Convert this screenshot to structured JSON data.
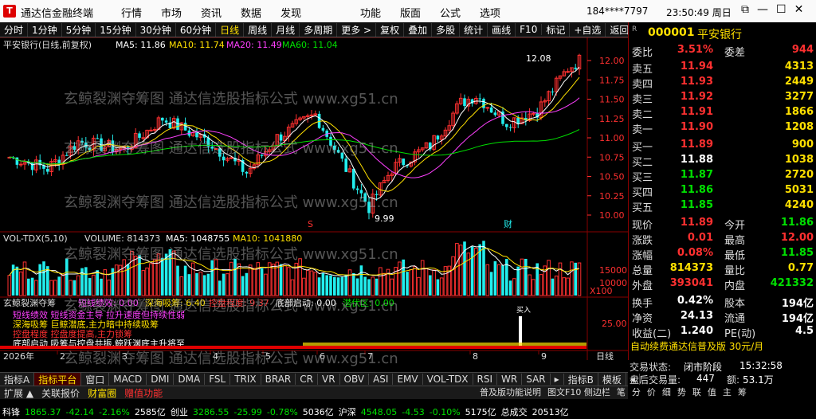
{
  "window": {
    "title": "通达信金融终端",
    "menu": [
      "行情",
      "市场",
      "资讯",
      "数据",
      "发现"
    ],
    "menu2": [
      "功能",
      "版面",
      "公式",
      "选项"
    ],
    "user": "184****7797",
    "clock": "23:50:49 周日"
  },
  "toolbar": [
    "分时",
    "1分钟",
    "5分钟",
    "15分钟",
    "30分钟",
    "60分钟",
    "日线",
    "周线",
    "月线",
    "多周期",
    "更多 >",
    "复权",
    "叠加",
    "多股",
    "统计",
    "画线",
    "F10",
    "标记",
    "+自选",
    "返回"
  ],
  "toolbar_selected": "日线",
  "main_chart": {
    "header": "平安银行(日线,前复权)",
    "ma5": "MA5: 11.86",
    "ma10": "MA10: 11.74",
    "ma20": "MA20: 11.49",
    "ma60": "MA60: 11.04",
    "high_label": "12.08",
    "low_label": "9.99",
    "marker_s": "S",
    "marker_cai": "财",
    "price_ticks": [
      "12.00",
      "11.75",
      "11.50",
      "11.25",
      "11.00",
      "10.75",
      "10.50",
      "10.25",
      "10.00"
    ]
  },
  "volume_chart": {
    "header": "VOL-TDX(5,10)",
    "volume": "VOLUME: 814373",
    "ma5": "MA5: 1048755",
    "ma10": "MA10: 1041880",
    "ticks": [
      "15000",
      "10000",
      "X100"
    ]
  },
  "indicator_chart": {
    "name": "玄鲸裂渊夺筹",
    "l1": "短线绩效: 0.00",
    "l2": "深海吸筹: 6.40",
    "l3": "控盘程度: 9.37",
    "l4": "底部启动: 0.00",
    "l5": "潜伏区: 0.00",
    "tip1": "短线绩效 短线资金主导 拉升速度但持续性弱",
    "tip2": "深海吸筹 巨鲸潜底,主力暗中持续吸筹",
    "tip3": "控盘程度 控盘度提高,主力锁筹",
    "tip4": "底部启动 吸筹与控盘共振,鲸跃渊底主升将至",
    "tag": "买入",
    "ticks": [
      "25.00"
    ]
  },
  "time_axis": {
    "year": "2026年",
    "labels": [
      "2",
      "3",
      "4",
      "5",
      "6",
      "7",
      "8",
      "9"
    ],
    "period": "日线"
  },
  "quote": {
    "code": "000001",
    "name": "平安银行",
    "weibi_label": "委比",
    "weibi": "3.51%",
    "weicha_label": "委差",
    "weicha": "944",
    "asks": [
      {
        "label": "卖五",
        "price": "11.94",
        "vol": "4313"
      },
      {
        "label": "卖四",
        "price": "11.93",
        "vol": "2449"
      },
      {
        "label": "卖三",
        "price": "11.92",
        "vol": "3277"
      },
      {
        "label": "卖二",
        "price": "11.91",
        "vol": "1866"
      },
      {
        "label": "卖一",
        "price": "11.90",
        "vol": "1208"
      }
    ],
    "bids": [
      {
        "label": "买一",
        "price": "11.89",
        "vol": "900"
      },
      {
        "label": "买二",
        "price": "11.88",
        "vol": "1038"
      },
      {
        "label": "买三",
        "price": "11.87",
        "vol": "2720"
      },
      {
        "label": "买四",
        "price": "11.86",
        "vol": "5031"
      },
      {
        "label": "买五",
        "price": "11.85",
        "vol": "4240"
      }
    ],
    "stats": [
      {
        "l1": "现价",
        "v1": "11.89",
        "l2": "今开",
        "v2": "11.86",
        "c1": "red",
        "c2": "green"
      },
      {
        "l1": "涨跌",
        "v1": "0.01",
        "l2": "最高",
        "v2": "12.00",
        "c1": "red",
        "c2": "red"
      },
      {
        "l1": "涨幅",
        "v1": "0.08%",
        "l2": "最低",
        "v2": "11.85",
        "c1": "red",
        "c2": "green"
      },
      {
        "l1": "总量",
        "v1": "814373",
        "l2": "量比",
        "v2": "0.77",
        "c1": "yellow",
        "c2": "yellow"
      },
      {
        "l1": "外盘",
        "v1": "393041",
        "l2": "内盘",
        "v2": "421332",
        "c1": "red",
        "c2": "green"
      }
    ],
    "stats2": [
      {
        "l1": "换手",
        "v1": "0.42%",
        "l2": "股本",
        "v2": "194亿"
      },
      {
        "l1": "净资",
        "v1": "24.13",
        "l2": "流通",
        "v2": "194亿"
      },
      {
        "l1": "收益(二)",
        "v1": "1.240",
        "l2": "PE(动)",
        "v2": "4.5"
      }
    ],
    "promo": "自动续费通达信普及版 30元/月",
    "status_label": "交易状态:",
    "status_value": "闭市阶段",
    "status_time": "15:32:58",
    "cum_label": "盘后交易量:",
    "cum_value": "447",
    "amount_label": "额:",
    "amount_value": "53.1万"
  },
  "tabs": [
    "指标A",
    "指标平台",
    "窗口",
    "MACD",
    "DMI",
    "DMA",
    "FSL",
    "TRIX",
    "BRAR",
    "CR",
    "VR",
    "OBV",
    "ASI",
    "EMV",
    "VOL-TDX",
    "RSI",
    "WR",
    "SAR",
    "▸",
    "指标B",
    "模板",
    "◂"
  ],
  "tabs_selected": "指标平台",
  "tabs2": [
    "扩展 ▲",
    "关联报价",
    "财富圈",
    "赠值功能"
  ],
  "tabs2_right": [
    "普及版功能说明",
    "图文F10 侧边栏",
    "笔",
    "分",
    "价",
    "细",
    "势",
    "联",
    "值",
    "主",
    "筹"
  ],
  "status": [
    {
      "text": "科锋",
      "c": "white"
    },
    {
      "text": "1865.37",
      "c": "green"
    },
    {
      "text": "-42.14",
      "c": "green"
    },
    {
      "text": "-2.16%",
      "c": "green"
    },
    {
      "text": "2585亿",
      "c": "white"
    },
    {
      "text": "创业",
      "c": "white"
    },
    {
      "text": "3286.55",
      "c": "green"
    },
    {
      "text": "-25.99",
      "c": "green"
    },
    {
      "text": "-0.78%",
      "c": "green"
    },
    {
      "text": "5036亿",
      "c": "white"
    },
    {
      "text": "沪深",
      "c": "white"
    },
    {
      "text": "4548.05",
      "c": "green"
    },
    {
      "text": "-4.53",
      "c": "green"
    },
    {
      "text": "-0.10%",
      "c": "green"
    },
    {
      "text": "5175亿",
      "c": "white"
    },
    {
      "text": "总成交",
      "c": "white"
    },
    {
      "text": "20513亿",
      "c": "white"
    }
  ],
  "watermark": "玄鲸裂渊夺筹图 通达信选股指标公式 www.xg51.cn",
  "colors": {
    "up": "#ff3030",
    "down": "#2ee",
    "ma5": "#ffffff",
    "ma10": "#ffe000",
    "ma20": "#ff40ff",
    "ma60": "#00e000"
  }
}
